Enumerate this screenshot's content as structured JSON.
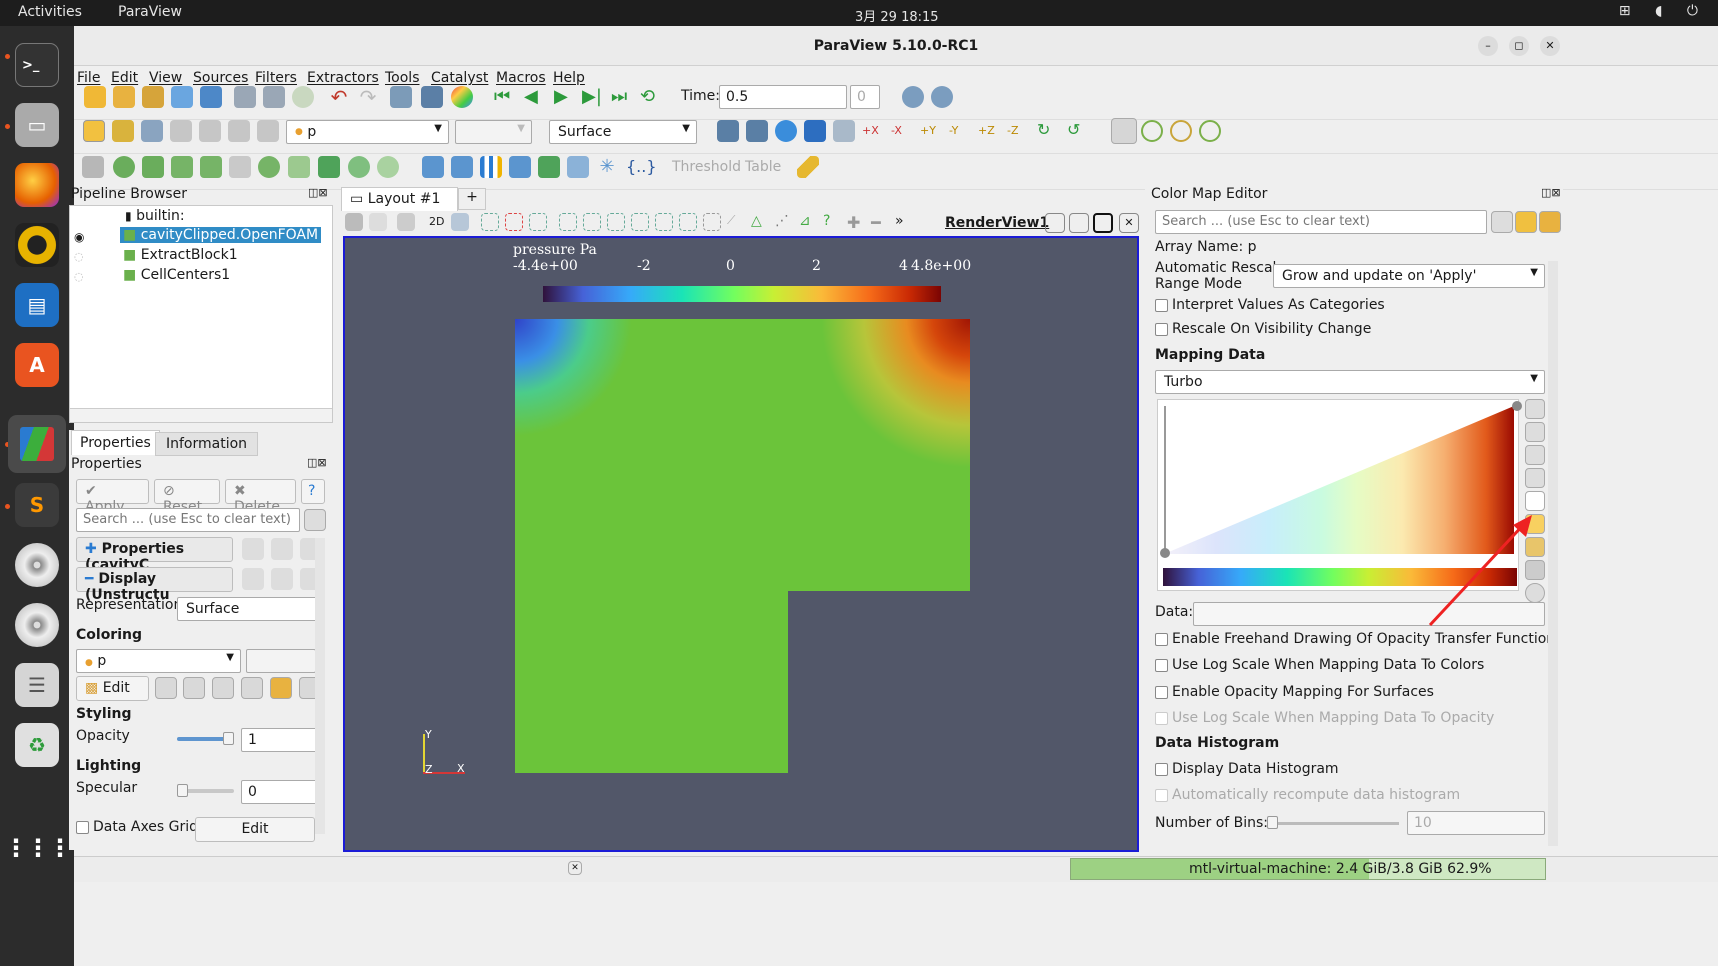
{
  "topbar": {
    "activities": "Activities",
    "app_name": "ParaView",
    "clock": "3月 29  18:15"
  },
  "window": {
    "title": "ParaView 5.10.0-RC1"
  },
  "menu": [
    "File",
    "Edit",
    "View",
    "Sources",
    "Filters",
    "Extractors",
    "Tools",
    "Catalyst",
    "Macros",
    "Help"
  ],
  "toolbar": {
    "time_label": "Time:",
    "time_value": "0.5",
    "timestep_value": "0",
    "color_array": "p",
    "representation": "Surface",
    "threshold_label": "Threshold",
    "table_label": "Table"
  },
  "pipeline": {
    "title": "Pipeline Browser",
    "items": [
      "builtin:",
      "cavityClipped.OpenFOAM",
      "ExtractBlock1",
      "CellCenters1"
    ]
  },
  "properties": {
    "tabs": [
      "Properties",
      "Information"
    ],
    "title": "Properties",
    "apply": "Apply",
    "reset": "Reset",
    "delete": "Delete",
    "help": "?",
    "search_placeholder": "Search ... (use Esc to clear text)",
    "section_properties": "Properties (cavityC",
    "section_display": "Display (Unstructu",
    "representation_label": "Representation",
    "representation_value": "Surface",
    "coloring_label": "Coloring",
    "coloring_value": "p",
    "edit_label": "Edit",
    "styling_label": "Styling",
    "opacity_label": "Opacity",
    "opacity_value": "1",
    "lighting_label": "Lighting",
    "specular_label": "Specular",
    "specular_value": "0",
    "data_axes_label": "Data Axes Grid",
    "data_axes_edit": "Edit"
  },
  "layout": {
    "tab": "Layout #1",
    "add": "+",
    "view_name": "RenderView1",
    "mode_2d": "2D"
  },
  "render": {
    "legend_title": "pressure Pa",
    "ticks": [
      "-4.4e+00",
      "-2",
      "0",
      "2",
      "4",
      "4.8e+00"
    ],
    "axis_x": "X",
    "axis_y": "Y",
    "axis_z": "Z"
  },
  "colormap": {
    "title": "Color Map Editor",
    "search_placeholder": "Search ... (use Esc to clear text)",
    "array_name": "Array Name: p",
    "rescale_label_1": "Automatic Rescale",
    "rescale_label_2": "Range Mode",
    "rescale_value": "Grow and update on 'Apply'",
    "interpret_categories": "Interpret Values As Categories",
    "rescale_visibility": "Rescale On Visibility Change",
    "mapping_data": "Mapping Data",
    "preset": "Turbo",
    "data_label": "Data:",
    "freehand": "Enable Freehand Drawing Of Opacity Transfer Function",
    "log_scale_colors": "Use Log Scale When Mapping Data To Colors",
    "opacity_surfaces": "Enable Opacity Mapping For Surfaces",
    "log_scale_opacity": "Use Log Scale When Mapping Data To Opacity",
    "histogram_title": "Data Histogram",
    "display_histogram": "Display Data Histogram",
    "auto_recompute": "Automatically recompute data histogram",
    "bins_label": "Number of Bins:",
    "bins_value": "10"
  },
  "status": {
    "memory": "mtl-virtual-machine: 2.4 GiB/3.8 GiB 62.9%",
    "memory_fraction": 0.629
  },
  "colors": {
    "accent": "#e95420",
    "selection": "#308cc6",
    "render_bg": "#525769",
    "field": "#6bc43a"
  }
}
